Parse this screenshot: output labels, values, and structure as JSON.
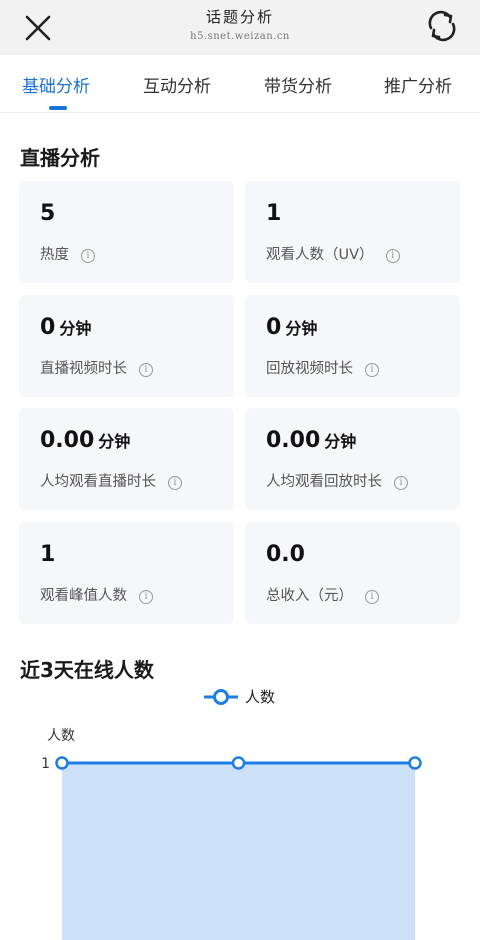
{
  "header": {
    "title": "话题分析",
    "url": "h5.snet.weizan.cn"
  },
  "tabs": [
    {
      "label": "基础分析",
      "active": true
    },
    {
      "label": "互动分析",
      "active": false
    },
    {
      "label": "带货分析",
      "active": false
    },
    {
      "label": "推广分析",
      "active": false
    }
  ],
  "live": {
    "title": "直播分析",
    "stats": [
      {
        "value": "5",
        "unit": "",
        "label": "热度"
      },
      {
        "value": "1",
        "unit": "",
        "label": "观看人数（UV）"
      },
      {
        "value": "0",
        "unit": "分钟",
        "label": "直播视频时长"
      },
      {
        "value": "0",
        "unit": "分钟",
        "label": "回放视频时长"
      },
      {
        "value": "0.00",
        "unit": "分钟",
        "label": "人均观看直播时长"
      },
      {
        "value": "0.00",
        "unit": "分钟",
        "label": "人均观看回放时长"
      },
      {
        "value": "1",
        "unit": "",
        "label": "观看峰值人数"
      },
      {
        "value": "0.0",
        "unit": "",
        "label": "总收入（元）"
      }
    ],
    "info_glyph": "i"
  },
  "online": {
    "title": "近3天在线人数"
  },
  "chart_data": {
    "type": "area",
    "ylabel": "人数",
    "legend": [
      "人数"
    ],
    "legend_position": "top-center",
    "y_tick_labels": [
      "1"
    ],
    "series": [
      {
        "name": "人数",
        "values": [
          1,
          1,
          1
        ]
      }
    ],
    "color": "#1e7ee3",
    "fill_color": "#cce1f8"
  },
  "colors": {
    "accent": "#1874d9",
    "card_bg": "#f6f7fb"
  },
  "icons": {
    "close": "close-icon",
    "refresh": "refresh-icon",
    "info": "info-icon"
  }
}
